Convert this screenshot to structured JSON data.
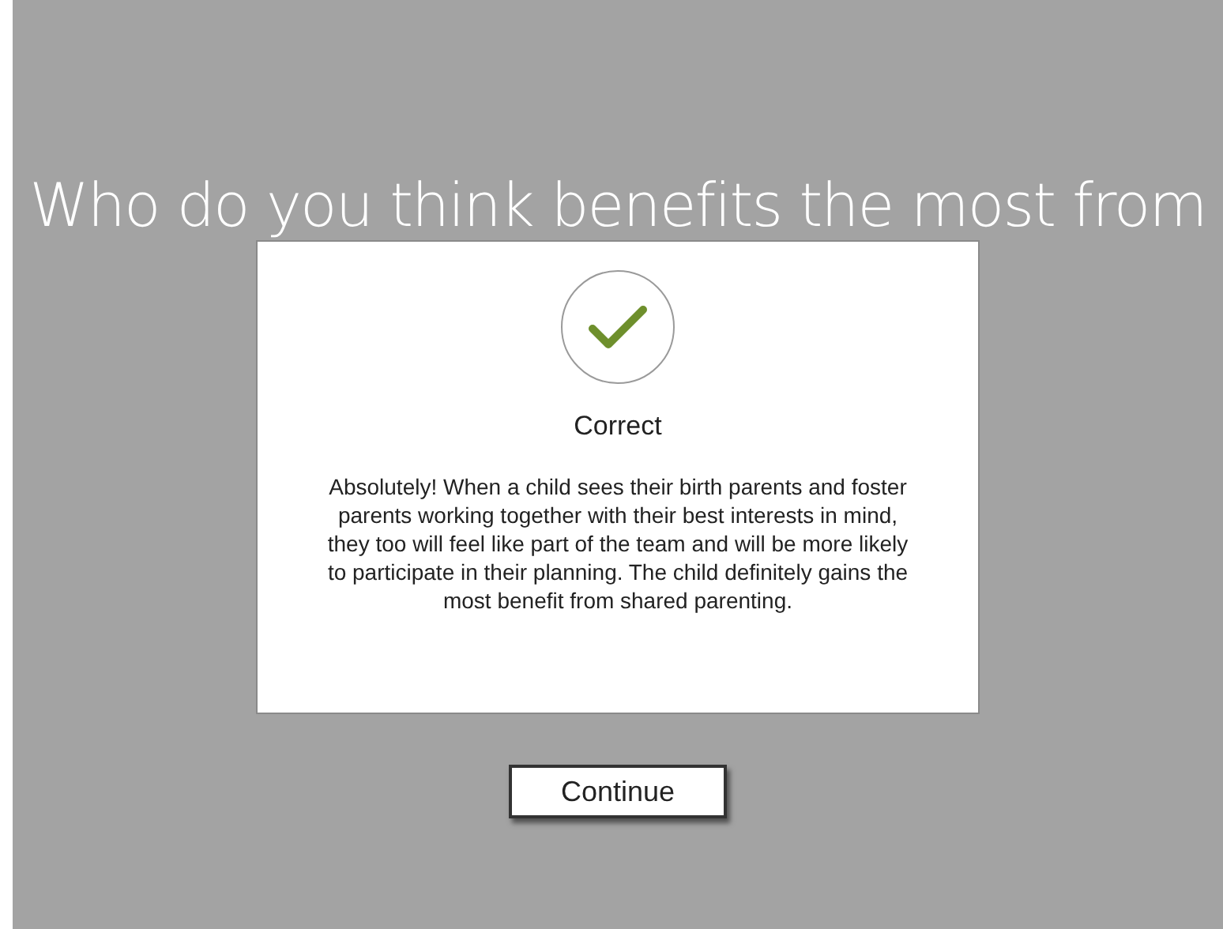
{
  "question": "Who do you think benefits the most from",
  "feedback": {
    "correct": true,
    "title": "Correct",
    "message": "Absolutely! When a child sees their birth parents and foster parents working together with their best interests in mind, they too will feel like part of the team and will be more likely to participate in their planning. The child definitely gains the most benefit from shared parenting."
  },
  "continue_button": "Continue"
}
